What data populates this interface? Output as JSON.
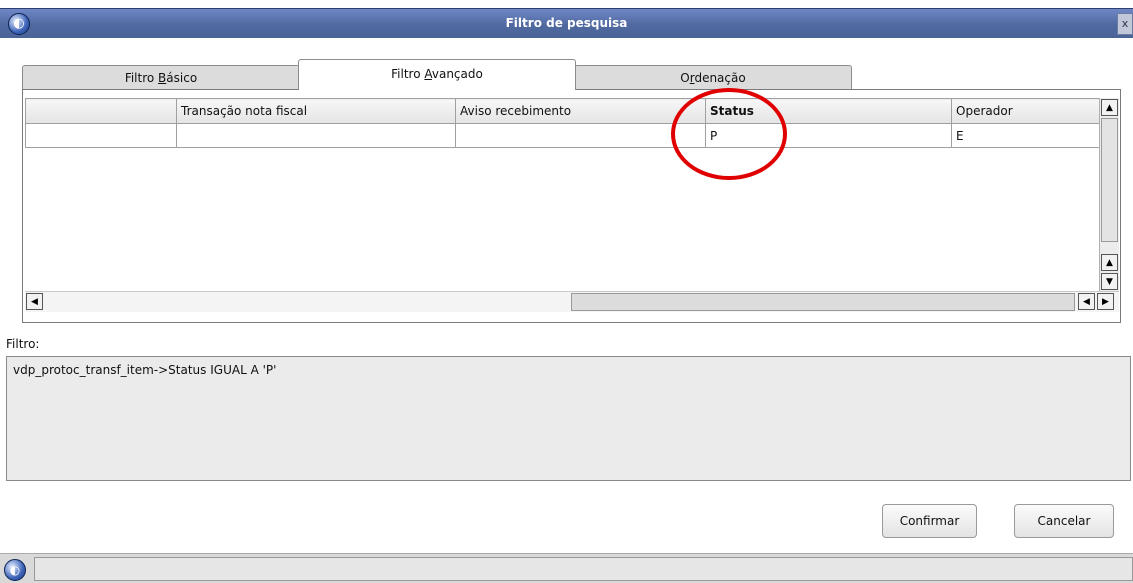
{
  "window": {
    "title": "Filtro de pesquisa",
    "app_icon": "app-logo-icon",
    "close_label": "x"
  },
  "tabs": [
    {
      "pre": "Filtro ",
      "key": "B",
      "post": "ásico",
      "active": false
    },
    {
      "pre": "Filtro ",
      "key": "A",
      "post": "vançado",
      "active": true
    },
    {
      "pre": "O",
      "key": "r",
      "post": "denação",
      "active": false
    }
  ],
  "grid": {
    "columns": [
      "",
      "Transação nota fiscal",
      "Aviso recebimento",
      "Status",
      "Operador"
    ],
    "rows": [
      [
        "",
        "",
        "",
        "P",
        "E"
      ]
    ]
  },
  "filter": {
    "label": "Filtro:",
    "expression": "vdp_protoc_transf_item->Status IGUAL A 'P'"
  },
  "buttons": {
    "confirm": "Confirmar",
    "cancel": "Cancelar"
  },
  "colors": {
    "titlebar": "#50699f",
    "highlight_circle": "#e00000"
  }
}
